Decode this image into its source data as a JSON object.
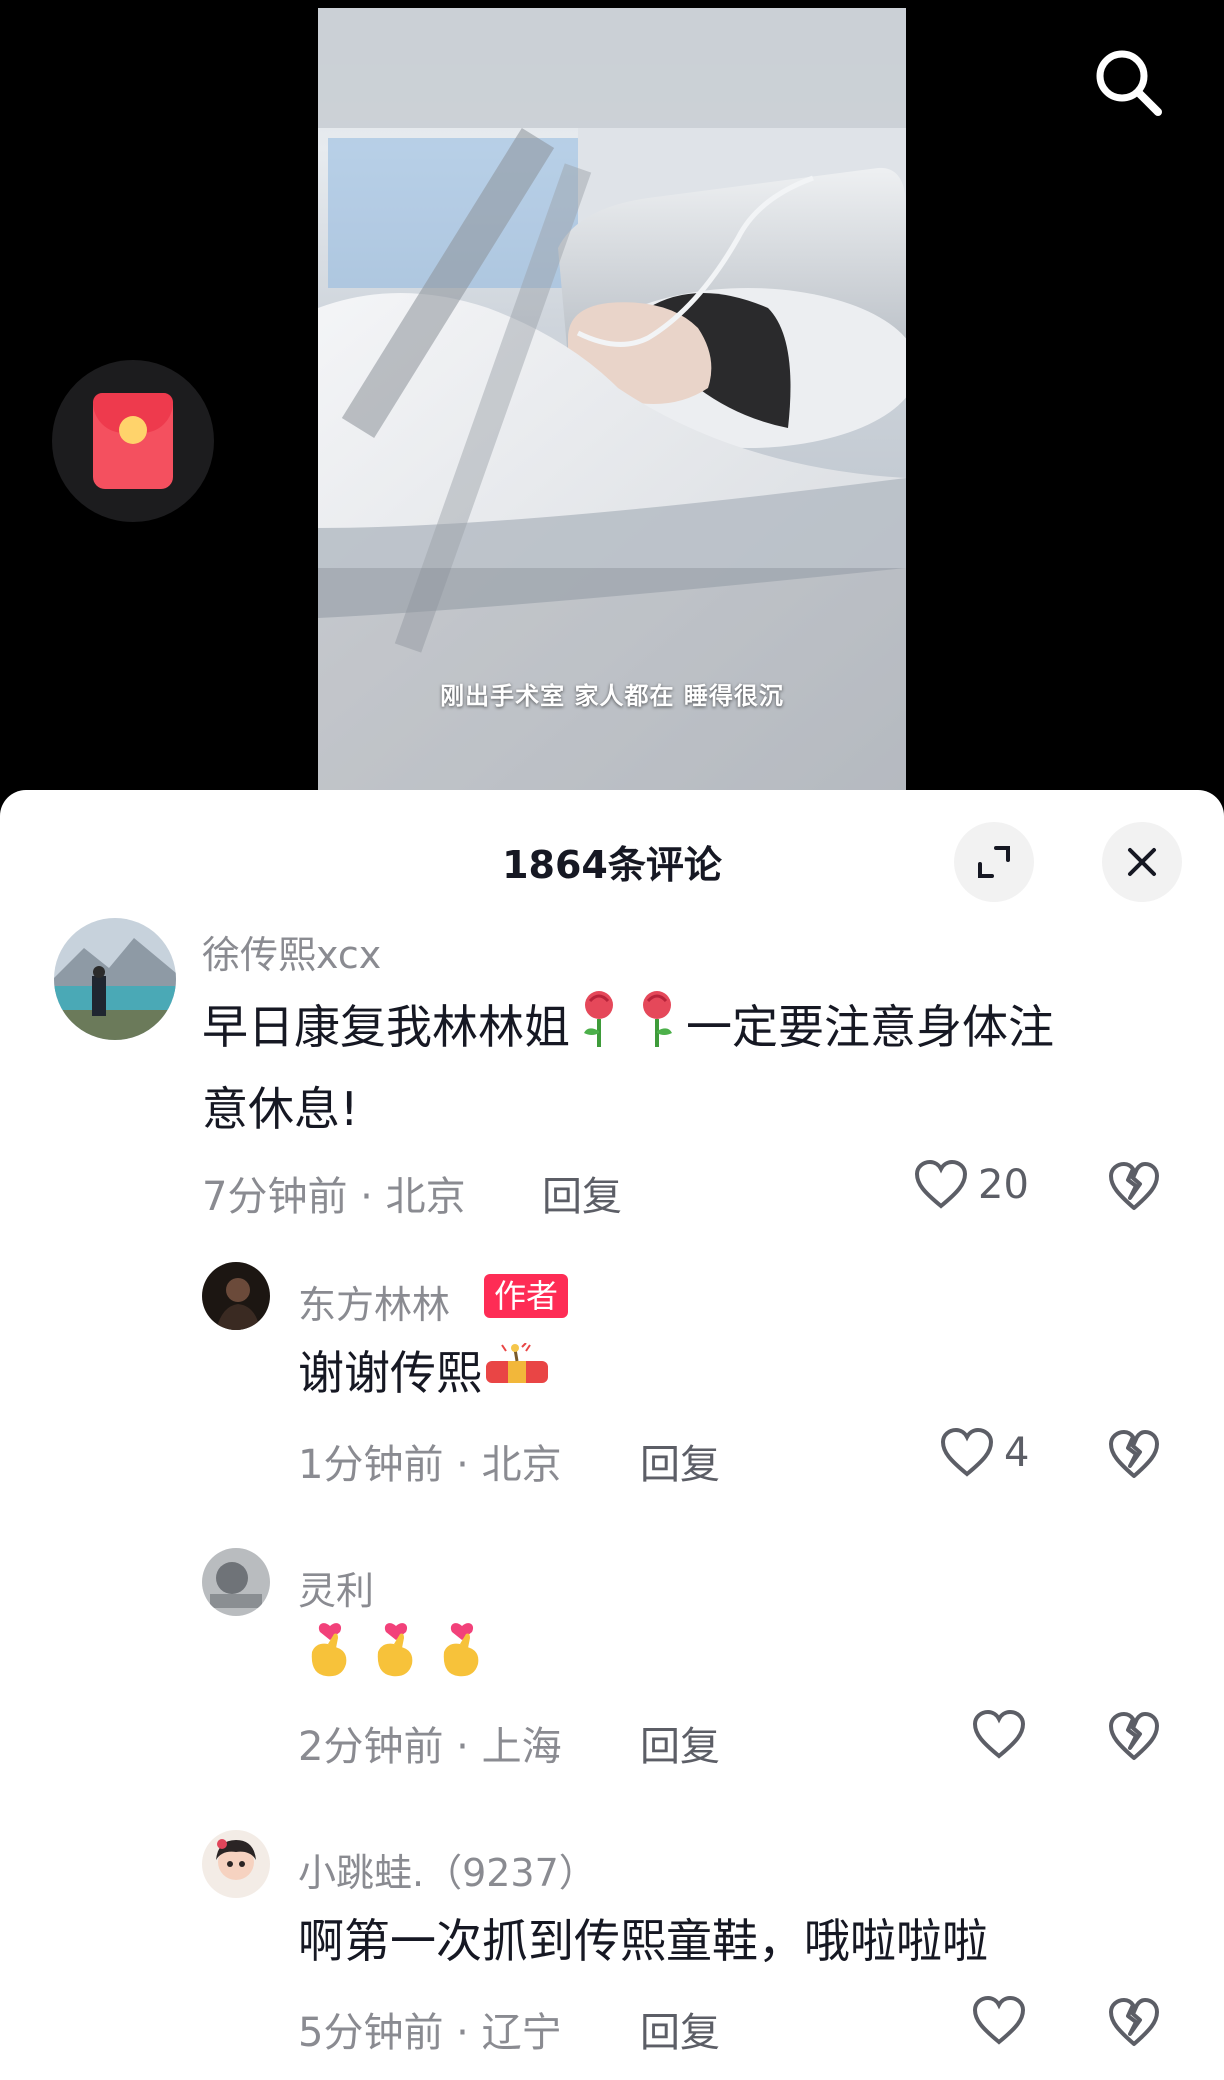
{
  "video": {
    "caption": "刚出手术室 家人都在 睡得很沉"
  },
  "icons": {
    "search": "search-icon",
    "red_packet": "red-packet-icon",
    "expand": "expand-icon",
    "close": "close-icon",
    "like": "heart-icon",
    "dislike": "broken-heart-icon"
  },
  "comments_panel": {
    "title": "1864条评论"
  },
  "comments": [
    {
      "user": "徐传熙xcx",
      "text_line1": "早日康复我林林姐",
      "text_line1_after": "一定要注意身体注",
      "text_line2": "意休息!",
      "emoji": [
        "rose",
        "rose"
      ],
      "time": "7分钟前",
      "location": "北京",
      "reply_label": "回复",
      "likes": "20"
    },
    {
      "user": "东方林林",
      "badge": "作者",
      "text": "谢谢传熙",
      "emoji": [
        "firecracker"
      ],
      "time": "1分钟前",
      "location": "北京",
      "reply_label": "回复",
      "likes": "4"
    },
    {
      "user": "灵利",
      "text": "",
      "emoji": [
        "finger-heart",
        "finger-heart",
        "finger-heart"
      ],
      "time": "2分钟前",
      "location": "上海",
      "reply_label": "回复",
      "likes": ""
    },
    {
      "user": "小跳蛙.（9237）",
      "text": "啊第一次抓到传熙童鞋，哦啦啦啦",
      "time": "5分钟前",
      "location": "辽宁",
      "reply_label": "回复",
      "likes": ""
    }
  ],
  "meta_separator": "·",
  "colors": {
    "accent": "#fe2c55",
    "text_primary": "#161823",
    "text_secondary": "#8a8b91",
    "red_packet": "#f4505f"
  }
}
